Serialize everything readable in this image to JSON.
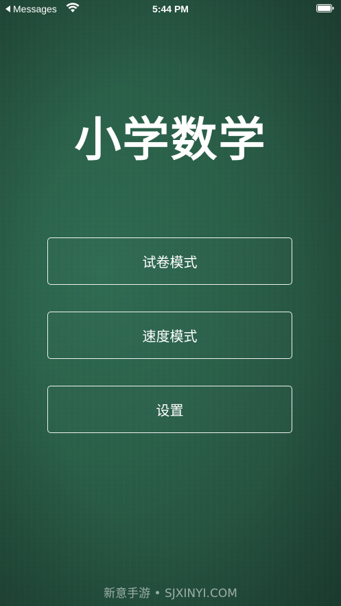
{
  "status_bar": {
    "back_app": "Messages",
    "time": "5:44 PM"
  },
  "title": "小学数学",
  "menu": {
    "buttons": [
      {
        "label": "试卷模式"
      },
      {
        "label": "速度模式"
      },
      {
        "label": "设置"
      }
    ]
  },
  "watermark": "新意手游 • SJXINYI.COM",
  "colors": {
    "background": "#2a5f48",
    "text": "#ffffff"
  }
}
